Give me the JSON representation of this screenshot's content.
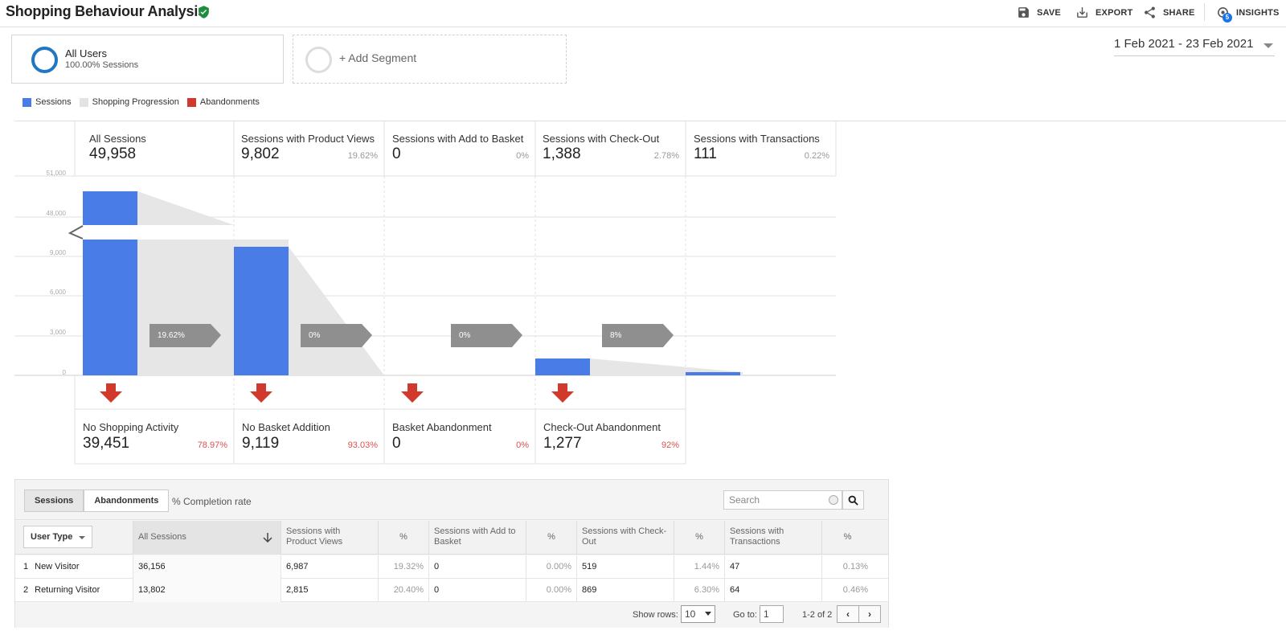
{
  "header": {
    "title": "Shopping Behaviour Analysis",
    "verified_icon": "check-shield-icon",
    "actions": {
      "save": "SAVE",
      "export": "EXPORT",
      "share": "SHARE",
      "insights": "INSIGHTS",
      "insights_badge": "5"
    }
  },
  "segments": {
    "all_users": {
      "name": "All Users",
      "sub": "100.00% Sessions"
    },
    "add": "+ Add Segment"
  },
  "date_range": "1 Feb 2021 - 23 Feb 2021",
  "legend": {
    "sessions": "Sessions",
    "progression": "Shopping Progression",
    "abandonments": "Abandonments",
    "colors": {
      "sessions": "#4a7ce8",
      "progression": "#e8e8e8",
      "abandonments": "#d0392b"
    }
  },
  "y_axis": [
    "51,000",
    "48,000",
    "9,000",
    "6,000",
    "3,000",
    "0"
  ],
  "stages": [
    {
      "name": "All Sessions",
      "value": "49,958",
      "pct": ""
    },
    {
      "name": "Sessions with Product Views",
      "value": "9,802",
      "pct": "19.62%"
    },
    {
      "name": "Sessions with Add to Basket",
      "value": "0",
      "pct": "0%"
    },
    {
      "name": "Sessions with Check-Out",
      "value": "1,388",
      "pct": "2.78%"
    },
    {
      "name": "Sessions with Transactions",
      "value": "111",
      "pct": "0.22%"
    }
  ],
  "conversion_tags": [
    "19.62%",
    "0%",
    "0%",
    "8%"
  ],
  "abandonments": [
    {
      "name": "No Shopping Activity",
      "value": "39,451",
      "pct": "78.97%"
    },
    {
      "name": "No Basket Addition",
      "value": "9,119",
      "pct": "93.03%"
    },
    {
      "name": "Basket Abandonment",
      "value": "0",
      "pct": "0%"
    },
    {
      "name": "Check-Out Abandonment",
      "value": "1,277",
      "pct": "92%"
    }
  ],
  "table": {
    "tabs": {
      "sessions": "Sessions",
      "abandonments": "Abandonments"
    },
    "completion_label": "% Completion rate",
    "search_placeholder": "Search",
    "dimension": "User Type",
    "headers": [
      "All Sessions",
      "Sessions with Product Views",
      "%",
      "Sessions with Add to Basket",
      "%",
      "Sessions with Check-Out",
      "%",
      "Sessions with Transactions",
      "%"
    ],
    "rows": [
      {
        "index": "1",
        "label": "New Visitor",
        "cells": [
          "36,156",
          "6,987",
          "19.32%",
          "0",
          "0.00%",
          "519",
          "1.44%",
          "47",
          "0.13%"
        ]
      },
      {
        "index": "2",
        "label": "Returning Visitor",
        "cells": [
          "13,802",
          "2,815",
          "20.40%",
          "0",
          "0.00%",
          "869",
          "6.30%",
          "64",
          "0.46%"
        ]
      }
    ],
    "footer": {
      "show_rows_label": "Show rows:",
      "show_rows_value": "10",
      "goto_label": "Go to:",
      "goto_value": "1",
      "range": "1-2 of 2"
    }
  }
}
